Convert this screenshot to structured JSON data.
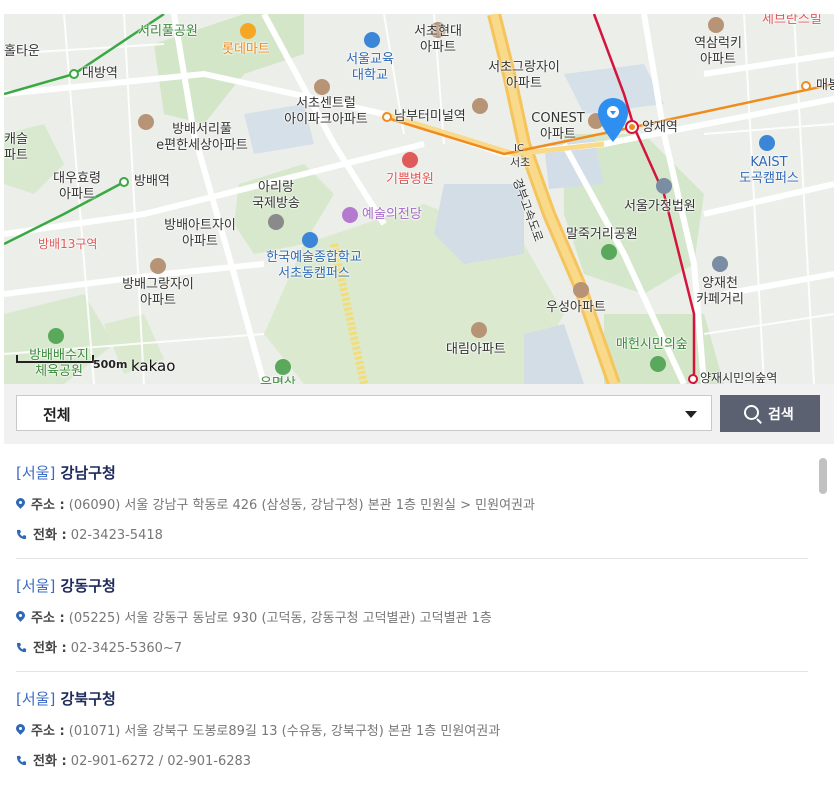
{
  "map": {
    "labels": {
      "seocho_park": "서리풀공원",
      "lotte_mart": "롯데마트",
      "seoul_edu_univ": "서울교육대학교",
      "seocho_hyundai_apt": "서초현대아파트",
      "yeoksam_kiki_apt": "역삼럭키아파트",
      "sebrance": "세브란스빌",
      "hwatown": "홀타운",
      "daebang_st": "대방역",
      "seocho_centrel_ipark": "서초센트럴아이파크아파트",
      "nambu_terminal": "남부터미널역",
      "seocho_grandjai": "서초그랑자이아파트",
      "maebong": "매봉",
      "conest": "CONEST아파트",
      "yangjae_st": "양재역",
      "kaist": "KAIST도곡캠퍼스",
      "bangbae_seoripul": "방배서리풀e편한세상아파트",
      "kaesul": "캐슬아파트",
      "daewoo_hyoryeong": "대우효령아파트",
      "bangbae_st": "방배역",
      "arirang": "아리랑국제방송",
      "gippeum": "기쁨병원",
      "seocho_ic": "서초",
      "ic": "IC",
      "seoul_court": "서울가정법원",
      "yesul": "예술의전당",
      "bangbae_art_jai": "방배아트자이아파트",
      "bangbae13": "방배13구역",
      "knua": "한국예술종합학교서초동캠퍼스",
      "maljuk_park": "말죽거리공원",
      "gyeongbu_exp": "경부고속도로",
      "bangbae_grand": "방배그랑자이아파트",
      "yangjaecheon_cafe": "양재천카페거리",
      "woosung": "우성아파트",
      "daerim": "대림아파트",
      "bangbae_reservoir": "방배배수지체육공원",
      "maeheon": "매헌시민의숲",
      "yangjae_citizen": "양재시민의숲역",
      "umyeon": "우면산"
    },
    "scale_label": "500m",
    "brand": "kakao"
  },
  "search": {
    "selected_region": "전체",
    "button_label": "검색"
  },
  "results": [
    {
      "region": "[서울]",
      "name": "강남구청",
      "address_label": "주소 :",
      "address": "(06090) 서울 강남구 학동로 426 (삼성동, 강남구청) 본관 1층 민원실 > 민원여권과",
      "phone_label": "전화 :",
      "phone": "02-3423-5418"
    },
    {
      "region": "[서울]",
      "name": "강동구청",
      "address_label": "주소 :",
      "address": "(05225) 서울 강동구 동남로 930 (고덕동, 강동구청 고덕별관) 고덕별관 1층",
      "phone_label": "전화 :",
      "phone": "02-3425-5360~7"
    },
    {
      "region": "[서울]",
      "name": "강북구청",
      "address_label": "주소 :",
      "address": "(01071) 서울 강북구 도봉로89길 13 (수유동, 강북구청) 본관 1층 민원여권과",
      "phone_label": "전화 :",
      "phone": "02-901-6272 / 02-901-6283"
    }
  ],
  "colors": {
    "accent_blue": "#3b6bc4",
    "title_navy": "#1d2a5a",
    "button_bg": "#5b6170",
    "subway_line2_green": "#3aa843",
    "subway_line3_orange": "#f08b1e",
    "sinbundang_red": "#d4143c"
  },
  "icons": {
    "marker": "location-pin-icon",
    "search": "search-icon",
    "address": "map-pin-icon",
    "phone": "phone-icon",
    "dropdown": "triangle-down-icon"
  }
}
